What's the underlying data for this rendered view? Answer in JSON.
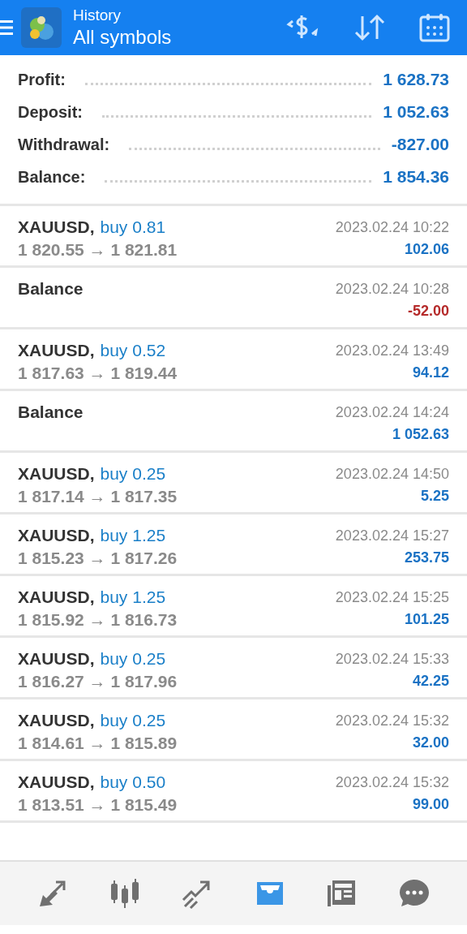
{
  "header": {
    "subtitle": "History",
    "title": "All symbols"
  },
  "summary": [
    {
      "label": "Profit:",
      "value": "1 628.73"
    },
    {
      "label": "Deposit:",
      "value": "1 052.63"
    },
    {
      "label": "Withdrawal:",
      "value": "-827.00"
    },
    {
      "label": "Balance:",
      "value": "1 854.36"
    }
  ],
  "deals": [
    {
      "kind": "trade",
      "symbol": "XAUUSD,",
      "side": "buy 0.81",
      "prices": "1 820.55 → 1 821.81",
      "time": "2023.02.24 10:22",
      "amount": "102.06",
      "negative": false
    },
    {
      "kind": "balance",
      "symbol": "Balance",
      "time": "2023.02.24 10:28",
      "amount": "-52.00",
      "negative": true
    },
    {
      "kind": "trade",
      "symbol": "XAUUSD,",
      "side": "buy 0.52",
      "prices": "1 817.63 → 1 819.44",
      "time": "2023.02.24 13:49",
      "amount": "94.12",
      "negative": false
    },
    {
      "kind": "balance",
      "symbol": "Balance",
      "time": "2023.02.24 14:24",
      "amount": "1 052.63",
      "negative": false
    },
    {
      "kind": "trade",
      "symbol": "XAUUSD,",
      "side": "buy 0.25",
      "prices": "1 817.14 → 1 817.35",
      "time": "2023.02.24 14:50",
      "amount": "5.25",
      "negative": false
    },
    {
      "kind": "trade",
      "symbol": "XAUUSD,",
      "side": "buy 1.25",
      "prices": "1 815.23 → 1 817.26",
      "time": "2023.02.24 15:27",
      "amount": "253.75",
      "negative": false
    },
    {
      "kind": "trade",
      "symbol": "XAUUSD,",
      "side": "buy 1.25",
      "prices": "1 815.92 → 1 816.73",
      "time": "2023.02.24 15:25",
      "amount": "101.25",
      "negative": false
    },
    {
      "kind": "trade",
      "symbol": "XAUUSD,",
      "side": "buy 0.25",
      "prices": "1 816.27 → 1 817.96",
      "time": "2023.02.24 15:33",
      "amount": "42.25",
      "negative": false
    },
    {
      "kind": "trade",
      "symbol": "XAUUSD,",
      "side": "buy 0.25",
      "prices": "1 814.61 → 1 815.89",
      "time": "2023.02.24 15:32",
      "amount": "32.00",
      "negative": false
    },
    {
      "kind": "trade",
      "symbol": "XAUUSD,",
      "side": "buy 0.50",
      "prices": "1 813.51 → 1 815.49",
      "time": "2023.02.24 15:32",
      "amount": "99.00",
      "negative": false
    }
  ],
  "nav": [
    {
      "kind": "quotes",
      "selected": false
    },
    {
      "kind": "chart",
      "selected": false
    },
    {
      "kind": "trade",
      "selected": false
    },
    {
      "kind": "history",
      "selected": true
    },
    {
      "kind": "news",
      "selected": false
    },
    {
      "kind": "chat",
      "selected": false
    }
  ]
}
